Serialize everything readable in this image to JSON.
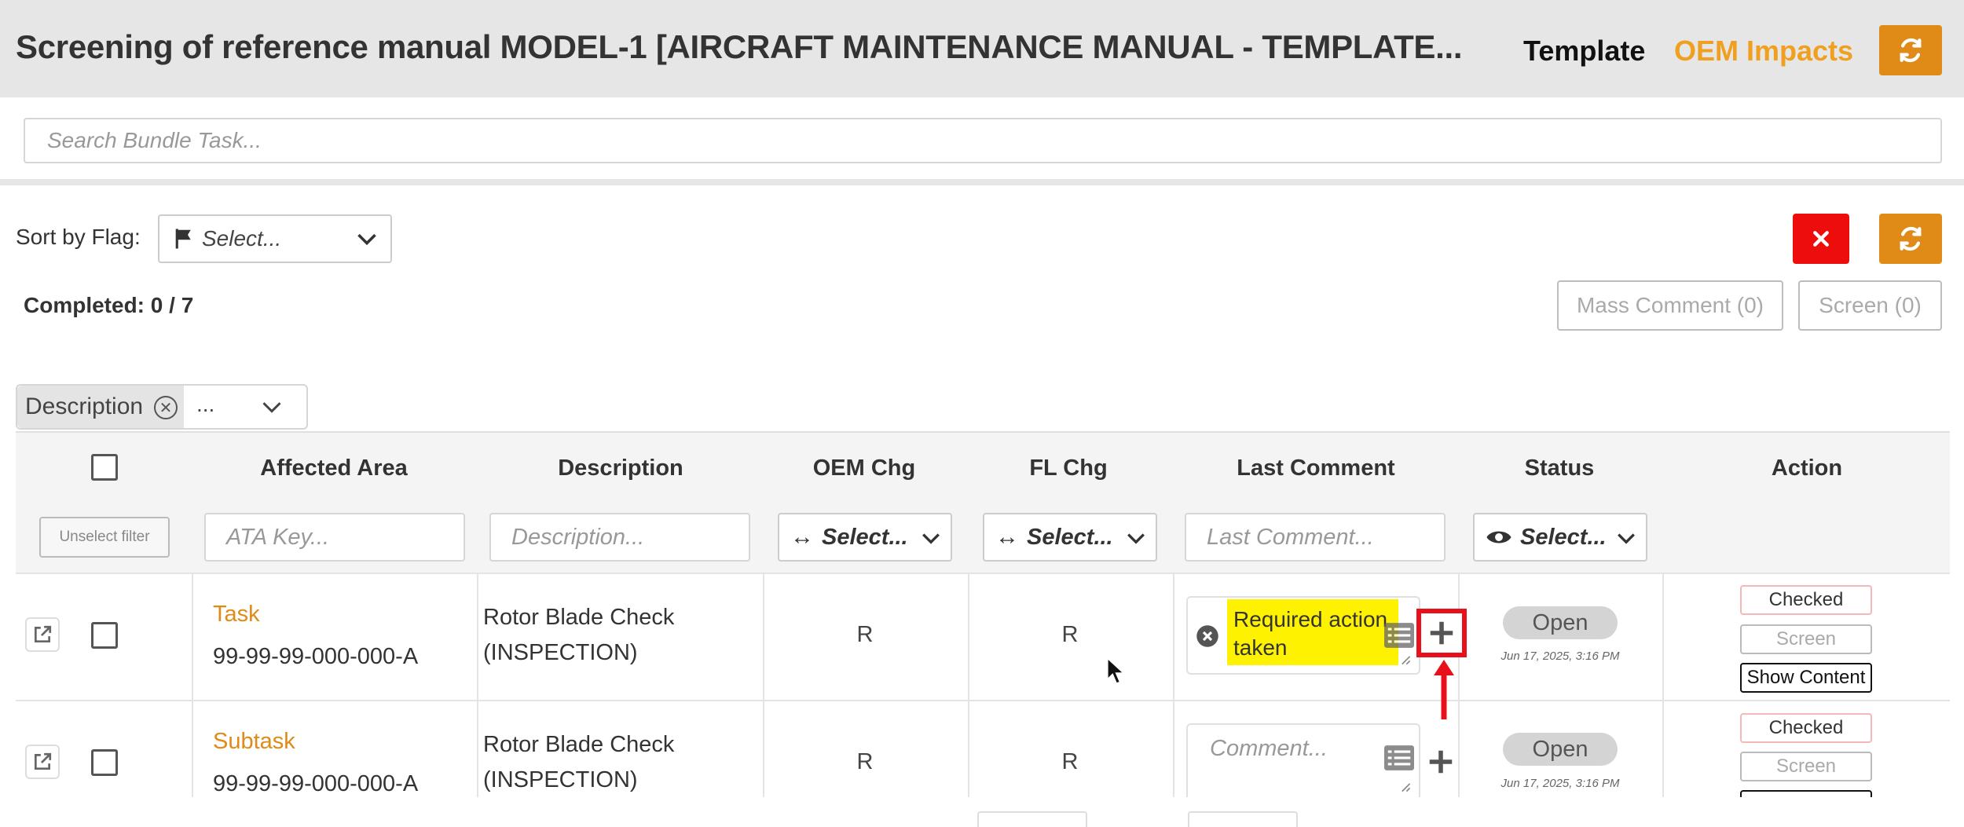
{
  "header": {
    "title": "Screening of reference manual MODEL-1 [AIRCRAFT MAINTENANCE MANUAL - TEMPLATE...",
    "template_link": "Template",
    "oem_impacts_link": "OEM Impacts"
  },
  "search": {
    "placeholder": "Search Bundle Task..."
  },
  "toolbar": {
    "sort_label": "Sort by Flag:",
    "sort_value": "Select...",
    "completed_label": "Completed: 0 / 7",
    "mass_comment": "Mass Comment (0)",
    "screen": "Screen (0)"
  },
  "column_filter": {
    "chip": "Description",
    "more": "..."
  },
  "table": {
    "headers": {
      "affected_area": "Affected Area",
      "description": "Description",
      "oem_chg": "OEM Chg",
      "fl_chg": "FL Chg",
      "last_comment": "Last Comment",
      "status": "Status",
      "action": "Action"
    },
    "filters": {
      "unselect": "Unselect filter",
      "ata_key": "ATA Key...",
      "description": "Description...",
      "oem_chg": "Select...",
      "fl_chg": "Select...",
      "last_comment": "Last Comment...",
      "status": "Select..."
    },
    "rows": [
      {
        "type": "Task",
        "key": "99-99-99-000-000-A",
        "desc_line1": "Rotor Blade Check",
        "desc_line2": "(INSPECTION)",
        "oem_chg": "R",
        "fl_chg": "R",
        "comment": "Required action taken",
        "status": "Open",
        "date": "Jun 17, 2025, 3:16 PM",
        "actions": {
          "checked": "Checked",
          "screen": "Screen",
          "show": "Show Content"
        }
      },
      {
        "type": "Subtask",
        "key": "99-99-99-000-000-A",
        "desc_line1": "Rotor Blade Check",
        "desc_line2": "(INSPECTION)",
        "oem_chg": "R",
        "fl_chg": "R",
        "comment_placeholder": "Comment...",
        "status": "Open",
        "date": "Jun 17, 2025, 3:16 PM",
        "actions": {
          "checked": "Checked",
          "screen": "Screen"
        }
      }
    ]
  },
  "colors": {
    "accent_orange": "#e08a17",
    "oem_link": "#f0a020",
    "danger_red": "#ee0d0d",
    "highlight_yellow": "#fff200",
    "annotation_red": "#e8101a"
  }
}
